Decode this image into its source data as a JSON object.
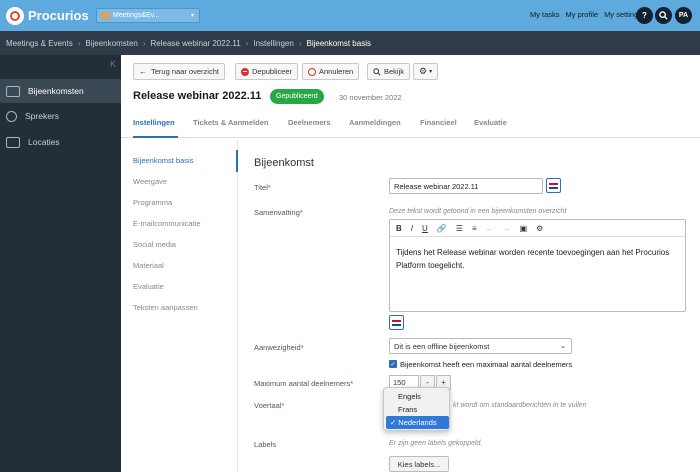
{
  "topbar": {
    "brand": "Procurios",
    "app_selector": "Meetings&Ev...",
    "links": [
      "My tasks",
      "My profile",
      "My settings"
    ],
    "help": "?",
    "avatar": "PA"
  },
  "breadcrumb": {
    "items": [
      "Meetings & Events",
      "Bijeenkomsten",
      "Release webinar 2022.11",
      "Instellingen"
    ],
    "current": "Bijeenkomst basis"
  },
  "sidebar": {
    "collapse": "K",
    "items": [
      {
        "label": "Bijeenkomsten",
        "active": true
      },
      {
        "label": "Sprekers"
      },
      {
        "label": "Locaties"
      }
    ]
  },
  "actions": {
    "back": "Terug naar overzicht",
    "depublish": "Depubliceer",
    "cancel": "Annuleren",
    "view": "Bekijk"
  },
  "event": {
    "title": "Release webinar 2022.11",
    "status": "Gepubliceerd",
    "date": "30 november 2022"
  },
  "tabs": [
    "Instellingen",
    "Tickets & Aanmelden",
    "Deelnemers",
    "Aanmeldingen",
    "Financieel",
    "Evaluatie"
  ],
  "subnav": [
    "Bijeenkomst basis",
    "Weergave",
    "Programma",
    "E-mailcommunicatie",
    "Social media",
    "Materiaal",
    "Evaluatie",
    "Teksten aanpassen"
  ],
  "form": {
    "section_title": "Bijeenkomst",
    "title_label": "Titel",
    "title_value": "Release webinar 2022.11",
    "summary_label": "Samenvatting",
    "summary_hint": "Deze tekst wordt getoond in een bijeenkomsten overzicht",
    "summary_text": "Tijdens het Release webinar worden recente toevoegingen aan het Procurios Platform toegelicht.",
    "toolbar": [
      "B",
      "I",
      "U"
    ],
    "presence_label": "Aanwezigheid",
    "presence_value": "Dit is een offline bijeenkomst",
    "max_check_label": "Bijeenkomst heeft een maximaal aantal deelnemers",
    "max_label": "Maximum aantal deelnemers",
    "max_value": "150",
    "minus": "-",
    "plus": "+",
    "language_label": "Voertaal",
    "language_hint_partial": "kt wordt om standaardberichten in te vullen",
    "language_options": [
      "Engels",
      "Frans",
      "Nederlands"
    ],
    "language_selected": "Nederlands",
    "labels_label": "Labels",
    "labels_hint": "Er zijn geen labels gekoppeld.",
    "labels_button": "Kies labels..."
  },
  "colors": {
    "topbar": "#5ea9dd",
    "sidebar": "#222e38",
    "accent": "#2c6fb7",
    "published": "#28a745"
  }
}
